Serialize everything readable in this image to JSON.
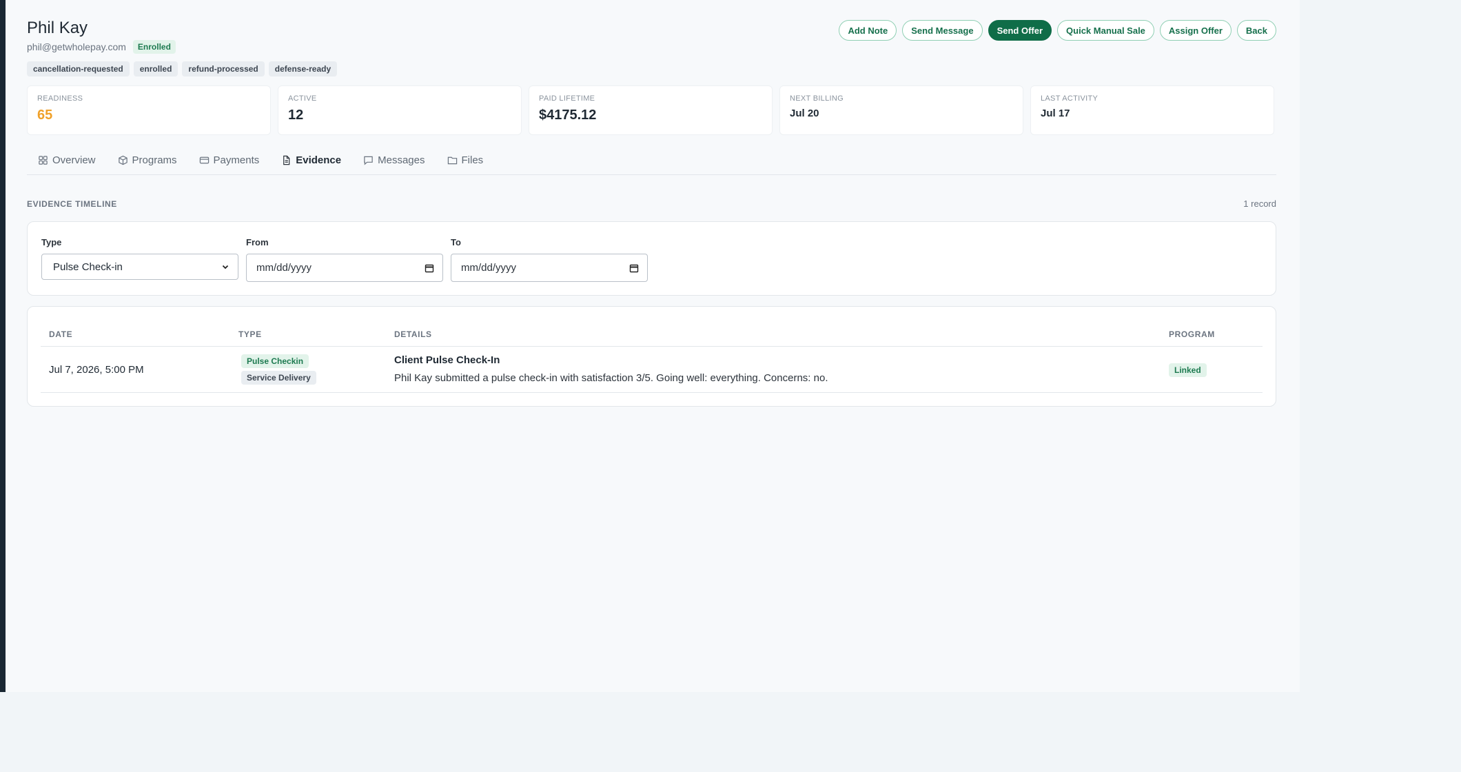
{
  "client": {
    "name": "Phil Kay",
    "email": "phil@getwholepay.com",
    "status": "Enrolled",
    "tags": [
      "cancellation-requested",
      "enrolled",
      "refund-processed",
      "defense-ready"
    ]
  },
  "actions": {
    "add_note": "Add Note",
    "send_message": "Send Message",
    "send_offer": "Send Offer",
    "quick_manual_sale": "Quick Manual Sale",
    "assign_offer": "Assign Offer",
    "back": "Back"
  },
  "stats": [
    {
      "label": "READINESS",
      "value": "65"
    },
    {
      "label": "ACTIVE",
      "value": "12"
    },
    {
      "label": "PAID LIFETIME",
      "value": "$4175.12"
    },
    {
      "label": "NEXT BILLING",
      "value": "Jul 20"
    },
    {
      "label": "LAST ACTIVITY",
      "value": "Jul 17"
    }
  ],
  "tabs": [
    {
      "label": "Overview",
      "icon": "grid-icon"
    },
    {
      "label": "Programs",
      "icon": "box-icon"
    },
    {
      "label": "Payments",
      "icon": "card-icon"
    },
    {
      "label": "Evidence",
      "icon": "document-icon",
      "active": true
    },
    {
      "label": "Messages",
      "icon": "message-icon"
    },
    {
      "label": "Files",
      "icon": "folder-icon"
    }
  ],
  "evidence": {
    "title": "EVIDENCE TIMELINE",
    "count": "1 record",
    "filters": {
      "type_label": "Type",
      "type_value": "Pulse Check-in",
      "from_label": "From",
      "from_placeholder": "mm/dd/yyyy",
      "to_label": "To",
      "to_placeholder": "mm/dd/yyyy"
    },
    "columns": [
      "DATE",
      "TYPE",
      "DETAILS",
      "PROGRAM"
    ],
    "rows": [
      {
        "date": "Jul 7, 2026, 5:00 PM",
        "type_primary": "Pulse Checkin",
        "type_secondary": "Service Delivery",
        "detail_title": "Client Pulse Check-In",
        "detail_text": "Phil Kay submitted a pulse check-in with satisfaction 3/5. Going well: everything. Concerns: no.",
        "program": "Linked"
      }
    ]
  },
  "colors": {
    "accent": "#0f6d48",
    "readiness": "#f0a12a",
    "sidebar": "#1a2733"
  }
}
